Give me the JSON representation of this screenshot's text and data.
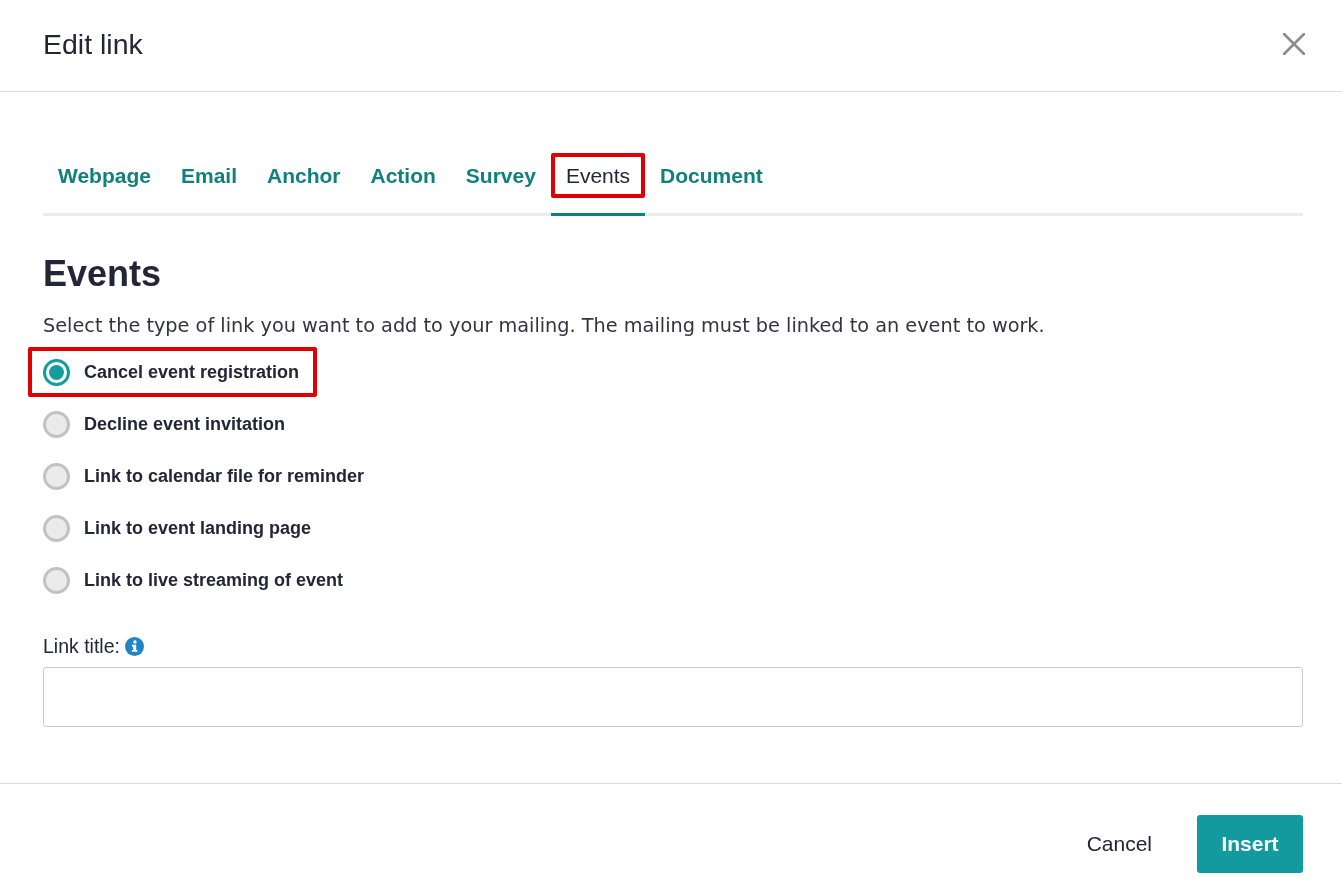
{
  "dialog": {
    "title": "Edit link"
  },
  "tabs": [
    {
      "label": "Webpage",
      "selected": false,
      "highlighted": false
    },
    {
      "label": "Email",
      "selected": false,
      "highlighted": false
    },
    {
      "label": "Anchor",
      "selected": false,
      "highlighted": false
    },
    {
      "label": "Action",
      "selected": false,
      "highlighted": false
    },
    {
      "label": "Survey",
      "selected": false,
      "highlighted": false
    },
    {
      "label": "Events",
      "selected": true,
      "highlighted": true
    },
    {
      "label": "Document",
      "selected": false,
      "highlighted": false
    }
  ],
  "section": {
    "heading": "Events",
    "description": "Select the type of link you want to add to your mailing. The mailing must be linked to an event to work."
  },
  "options": [
    {
      "label": "Cancel event registration",
      "selected": true,
      "highlighted": true
    },
    {
      "label": "Decline event invitation",
      "selected": false,
      "highlighted": false
    },
    {
      "label": "Link to calendar file for reminder",
      "selected": false,
      "highlighted": false
    },
    {
      "label": "Link to event landing page",
      "selected": false,
      "highlighted": false
    },
    {
      "label": "Link to live streaming of event",
      "selected": false,
      "highlighted": false
    }
  ],
  "link_title": {
    "label": "Link title:"
  },
  "buttons": [
    {
      "label": "Cancel",
      "kind": "secondary"
    },
    {
      "label": "Insert",
      "kind": "primary"
    }
  ]
}
